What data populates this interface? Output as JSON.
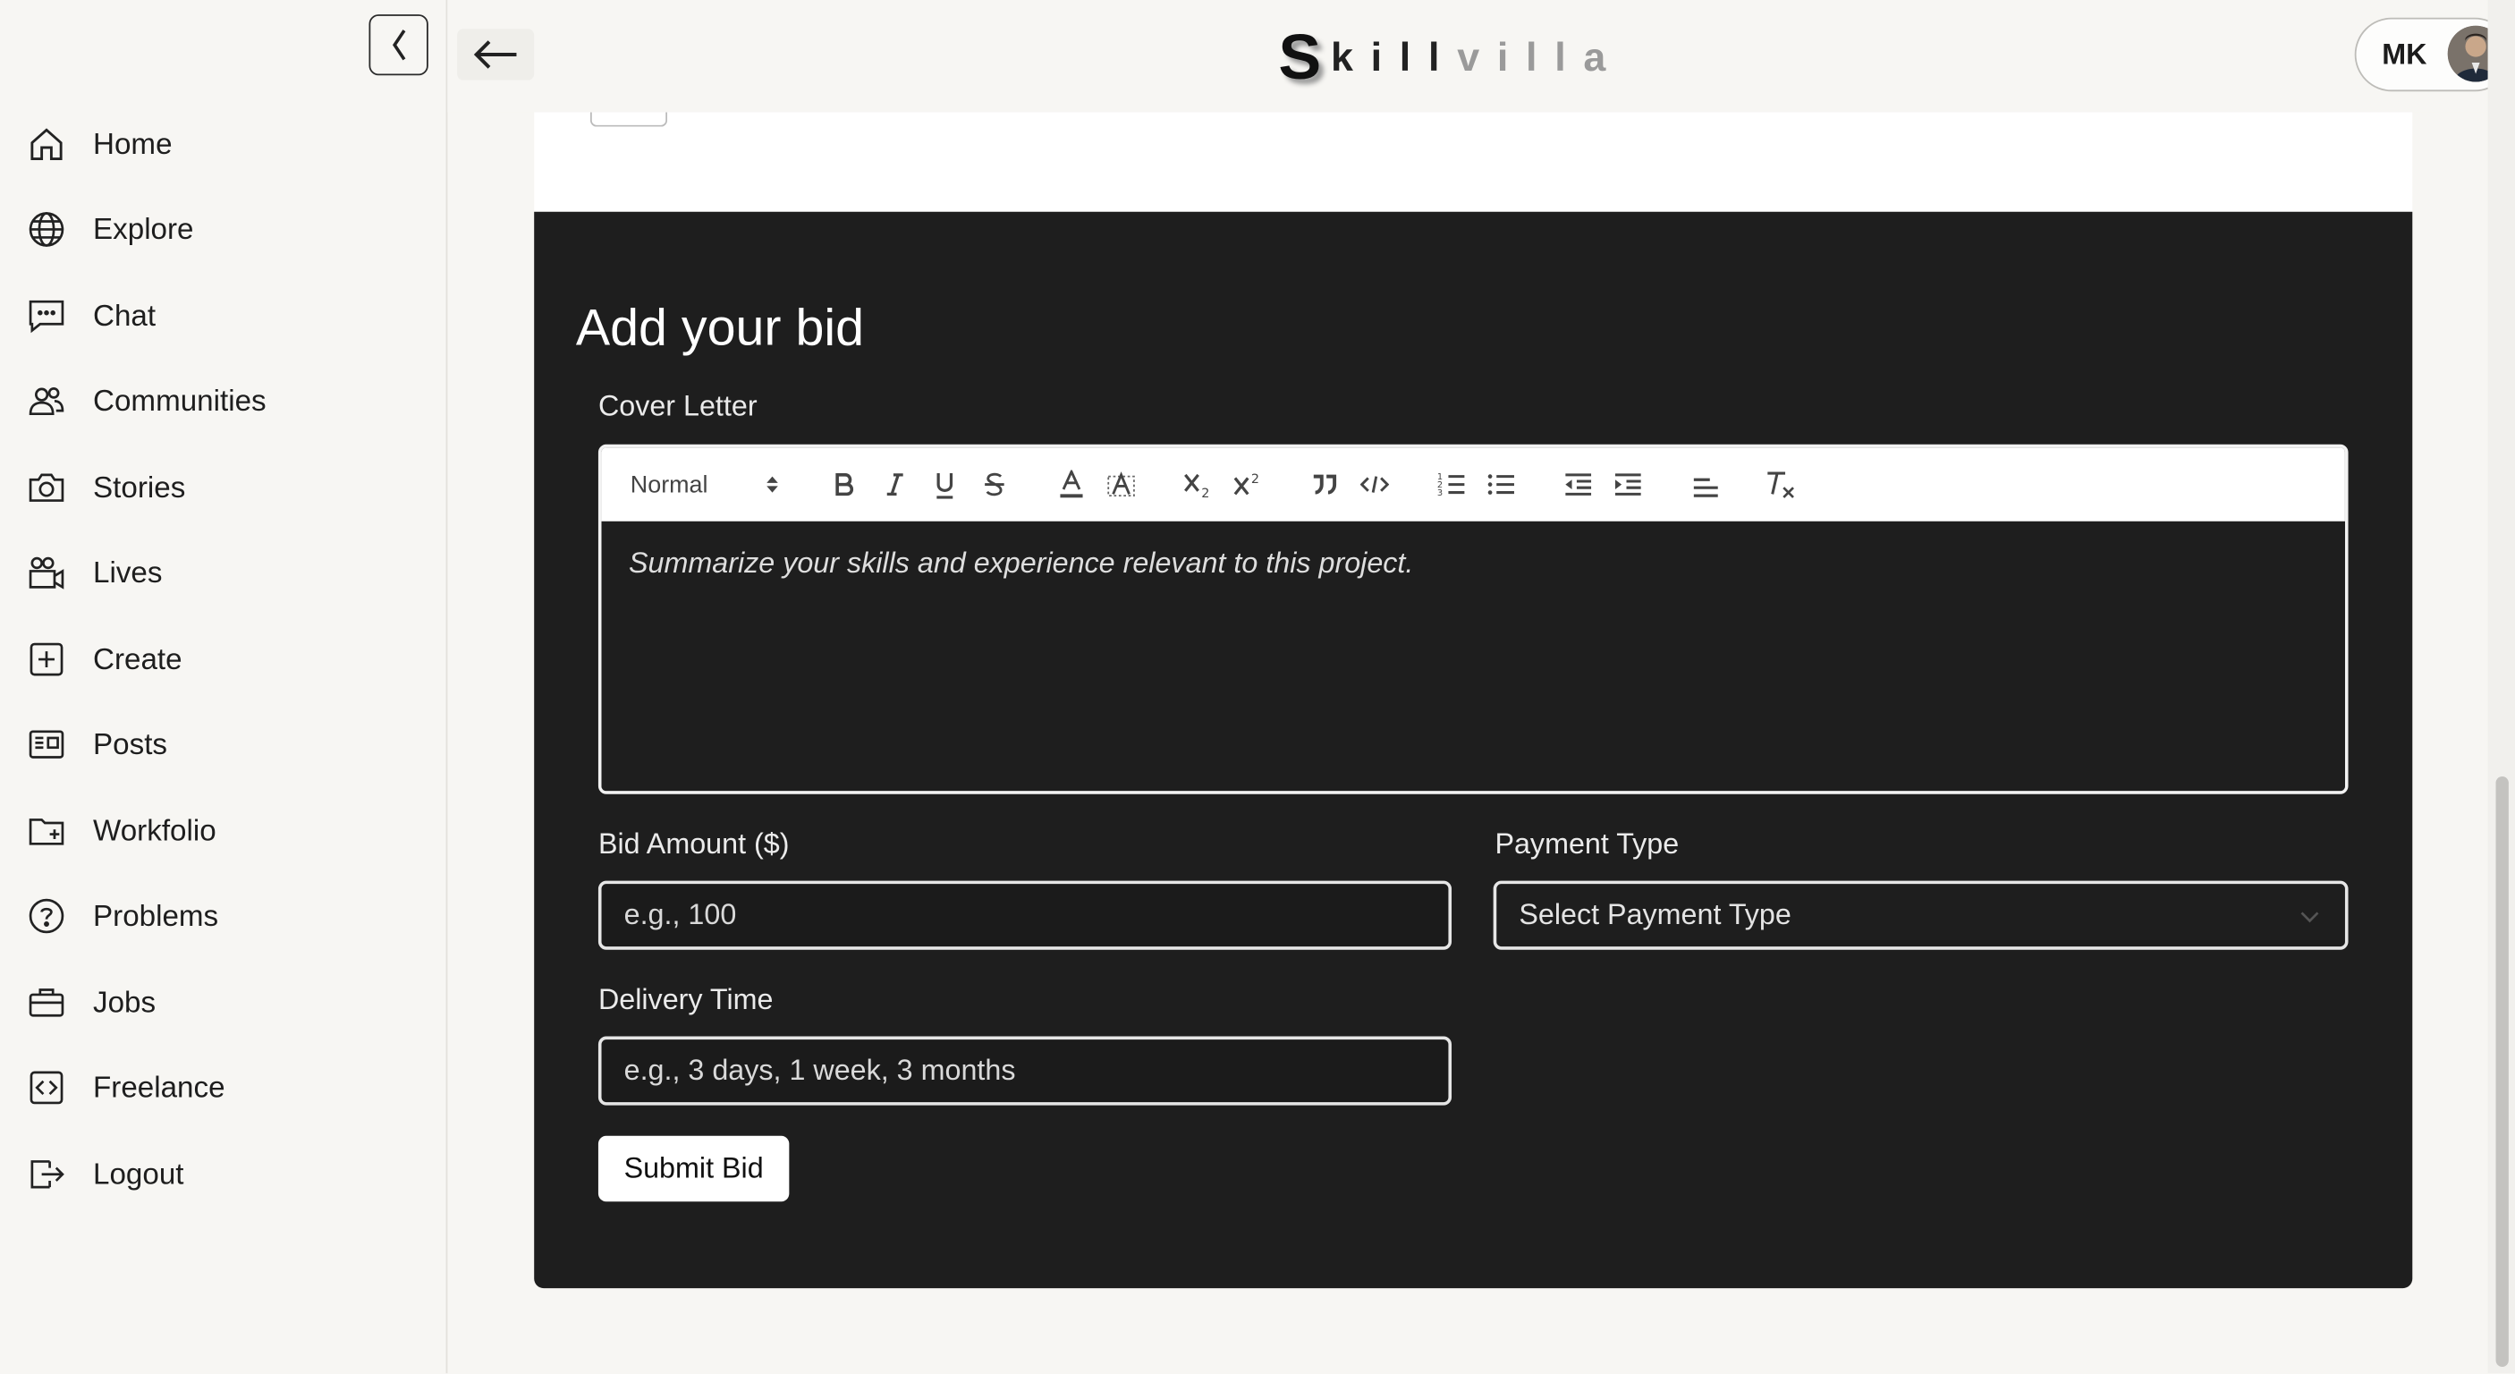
{
  "brand": {
    "logo_s": "S",
    "logo_bold": "kill",
    "logo_light": "villa"
  },
  "sidebar": {
    "items": [
      {
        "label": "Home",
        "icon": "home-icon"
      },
      {
        "label": "Explore",
        "icon": "globe-icon"
      },
      {
        "label": "Chat",
        "icon": "chat-icon"
      },
      {
        "label": "Communities",
        "icon": "people-icon"
      },
      {
        "label": "Stories",
        "icon": "camera-icon"
      },
      {
        "label": "Lives",
        "icon": "video-icon"
      },
      {
        "label": "Create",
        "icon": "plus-square-icon"
      },
      {
        "label": "Posts",
        "icon": "newspaper-icon"
      },
      {
        "label": "Workfolio",
        "icon": "folder-plus-icon"
      },
      {
        "label": "Problems",
        "icon": "question-circle-icon"
      },
      {
        "label": "Jobs",
        "icon": "briefcase-icon"
      },
      {
        "label": "Freelance",
        "icon": "code-square-icon"
      },
      {
        "label": "Logout",
        "icon": "logout-icon"
      }
    ]
  },
  "header": {
    "profile_initials": "MK"
  },
  "bid_form": {
    "title": "Add your bid",
    "cover_letter_label": "Cover Letter",
    "editor_format": "Normal",
    "cover_letter_placeholder": "Summarize your skills and experience relevant to this project.",
    "bid_amount_label": "Bid Amount ($)",
    "bid_amount_placeholder": "e.g., 100",
    "payment_type_label": "Payment Type",
    "payment_type_value": "Select Payment Type",
    "delivery_time_label": "Delivery Time",
    "delivery_time_placeholder": "e.g., 3 days, 1 week, 3 months",
    "submit_label": "Submit Bid"
  },
  "colors": {
    "panel_bg": "#1e1e1e",
    "page_bg": "#f7f6f3",
    "accent_white": "#ffffff"
  }
}
